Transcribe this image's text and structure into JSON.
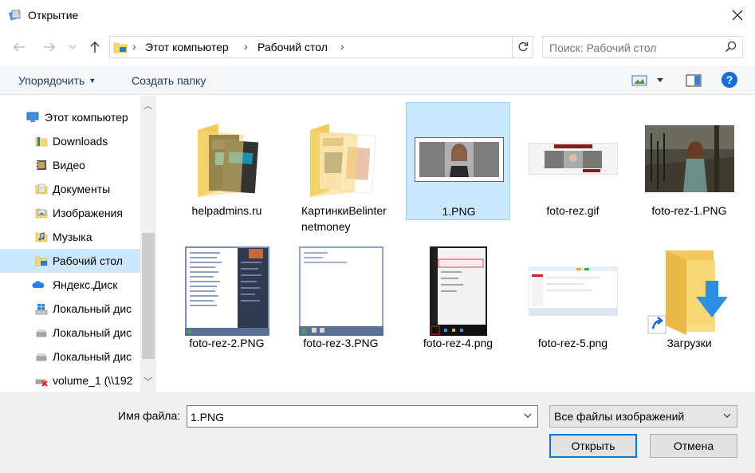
{
  "window": {
    "title": "Открытие",
    "close_glyph": "✕"
  },
  "nav": {
    "back_icon": "arrow-left-icon",
    "forward_icon": "arrow-right-icon",
    "up_icon": "arrow-up-icon",
    "breadcrumbs": [
      "Этот компьютер",
      "Рабочий стол"
    ],
    "search_placeholder": "Поиск: Рабочий стол"
  },
  "toolbar": {
    "organize_label": "Упорядочить",
    "new_folder_label": "Создать папку",
    "help_glyph": "?"
  },
  "sidebar": {
    "items": [
      {
        "label": "Этот компьютер",
        "icon": "computer-icon"
      },
      {
        "label": "Downloads",
        "icon": "folder-icon"
      },
      {
        "label": "Видео",
        "icon": "video-folder-icon"
      },
      {
        "label": "Документы",
        "icon": "documents-folder-icon"
      },
      {
        "label": "Изображения",
        "icon": "pictures-folder-icon"
      },
      {
        "label": "Музыка",
        "icon": "music-folder-icon"
      },
      {
        "label": "Рабочий стол",
        "icon": "desktop-folder-icon"
      },
      {
        "label": "Яндекс.Диск",
        "icon": "cloud-icon"
      },
      {
        "label": "Локальный дис",
        "icon": "windows-drive-icon"
      },
      {
        "label": "Локальный дис",
        "icon": "drive-icon"
      },
      {
        "label": "Локальный дис",
        "icon": "drive-icon"
      },
      {
        "label": "volume_1 (\\\\192",
        "icon": "network-drive-disconnected-icon"
      }
    ]
  },
  "files": [
    {
      "name": "helpadmins.ru",
      "kind": "folder"
    },
    {
      "name": "КартинкиBelinter\nnetmoney",
      "kind": "folder"
    },
    {
      "name": "1.PNG",
      "kind": "image"
    },
    {
      "name": "foto-rez.gif",
      "kind": "image"
    },
    {
      "name": "foto-rez-1.PNG",
      "kind": "image"
    },
    {
      "name": "foto-rez-2.PNG",
      "kind": "image"
    },
    {
      "name": "foto-rez-3.PNG",
      "kind": "image"
    },
    {
      "name": "foto-rez-4.png",
      "kind": "image"
    },
    {
      "name": "foto-rez-5.png",
      "kind": "image"
    },
    {
      "name": "Загрузки",
      "kind": "shortcut-folder"
    }
  ],
  "selected_file": "1.PNG",
  "bottom": {
    "filename_label": "Имя файла:",
    "filename_value": "1.PNG",
    "filetype_value": "Все файлы изображений",
    "open_label": "Открыть",
    "cancel_label": "Отмена"
  },
  "colors": {
    "selection": "#cce8ff",
    "accent": "#0078d7",
    "folder": "#f8d775"
  }
}
